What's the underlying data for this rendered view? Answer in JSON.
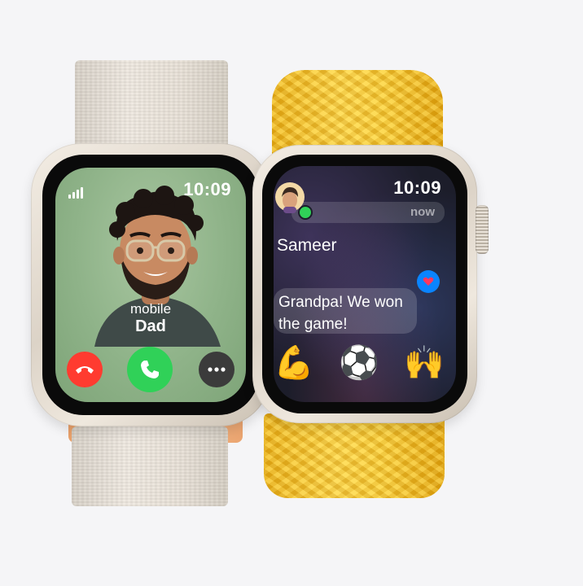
{
  "left_watch": {
    "time": "10:09",
    "caller_label": "mobile",
    "caller_name": "Dad",
    "decline_icon": "phone-hangup-icon",
    "accept_icon": "phone-icon",
    "more_icon": "ellipsis-icon",
    "colors": {
      "decline": "#ff3b30",
      "accept": "#30d158",
      "more": "#3b3b3b"
    }
  },
  "right_watch": {
    "time": "10:09",
    "notification_time": "now",
    "sender": "Sameer",
    "message": "Grandpa! We won the game!",
    "emojis": [
      "💪",
      "⚽",
      "🙌"
    ],
    "app_badge_icon": "messages-icon",
    "tapback_icon": "heart-icon",
    "colors": {
      "tapback": "#0a84ff",
      "badge": "#30d158"
    }
  }
}
